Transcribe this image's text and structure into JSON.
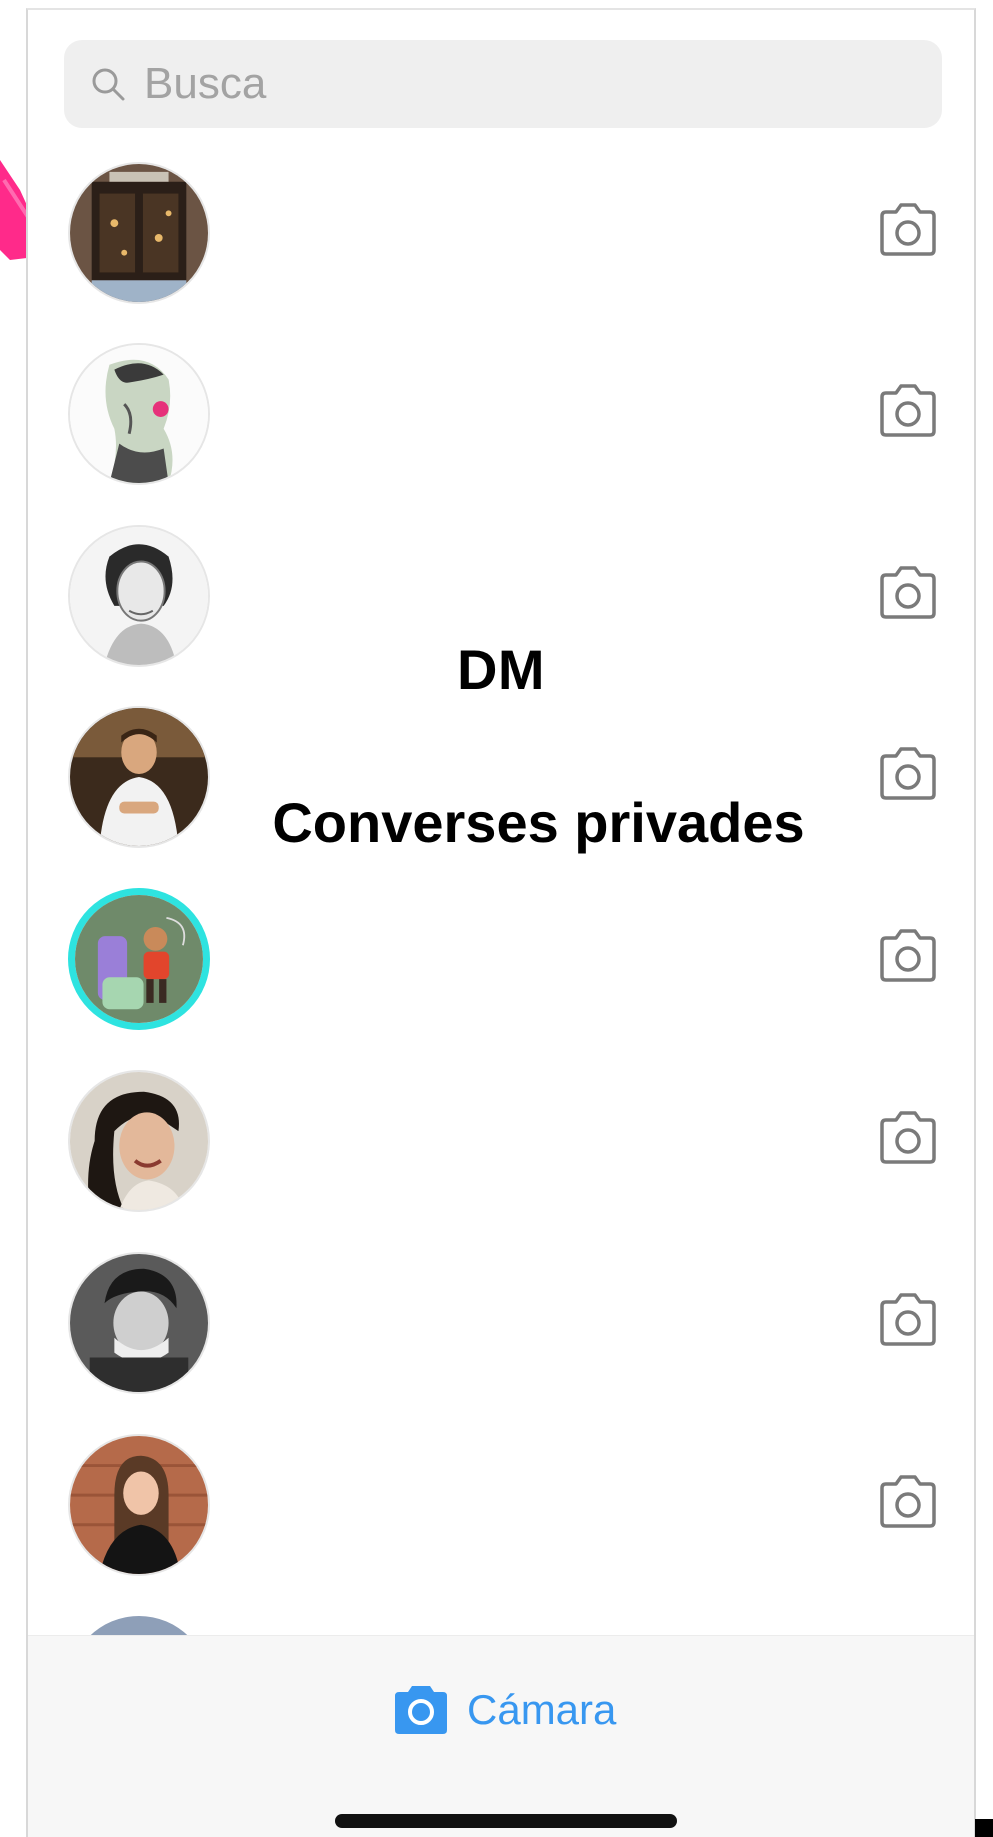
{
  "search": {
    "placeholder": "Busca",
    "icon": "search-icon"
  },
  "conversations": [
    {
      "avatar": "avatar-shop-window"
    },
    {
      "avatar": "avatar-illustrated-man"
    },
    {
      "avatar": "avatar-sketch-woman"
    },
    {
      "avatar": "avatar-man-white-shirt"
    },
    {
      "avatar": "avatar-cartoon-teal"
    },
    {
      "avatar": "avatar-smiling-woman"
    },
    {
      "avatar": "avatar-bw-man"
    },
    {
      "avatar": "avatar-woman-brick"
    }
  ],
  "overlay": {
    "title": "DM",
    "subtitle": "Converses privades"
  },
  "bottom_bar": {
    "camera_label": "Cámara"
  },
  "colors": {
    "accent": "#3897f0",
    "highlight": "#ff2a8a",
    "story_ring": "#2ee3e0"
  }
}
